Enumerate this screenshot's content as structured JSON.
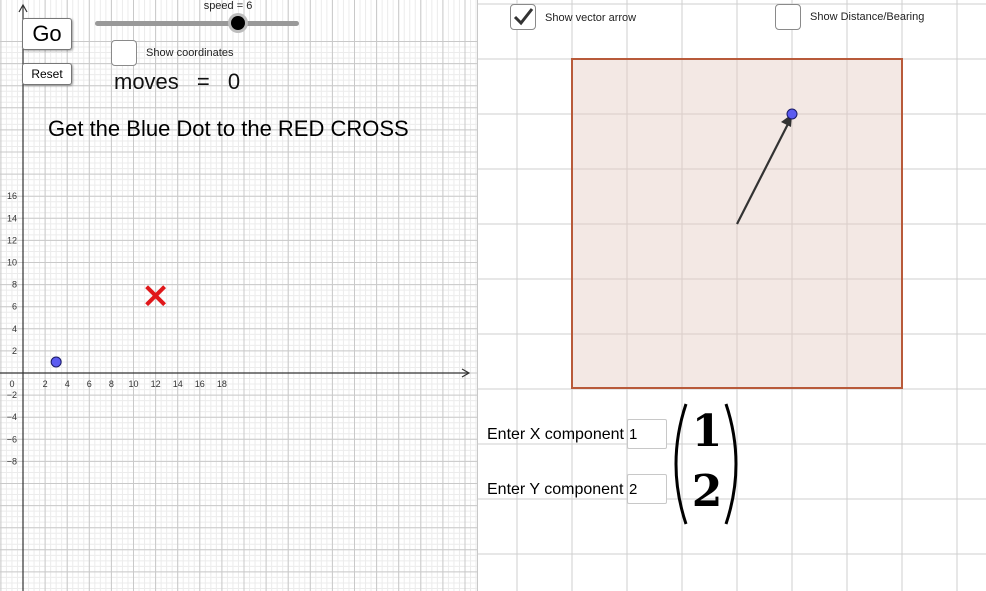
{
  "left_panel": {
    "go_label": "Go",
    "reset_label": "Reset",
    "slider_label": "speed = 6",
    "speed": {
      "min": 1,
      "max": 10,
      "value": 6
    },
    "show_coordinates_label": "Show coordinates",
    "show_coordinates_checked": false,
    "moves_label": "moves",
    "moves_eq": "=",
    "moves_value": "0",
    "instruction": "Get the Blue Dot to the RED CROSS",
    "graph": {
      "x_ticks": [
        "2",
        "4",
        "6",
        "8",
        "10",
        "12",
        "14",
        "16",
        "18"
      ],
      "y_ticks_pos": [
        "2",
        "4",
        "6",
        "8",
        "10",
        "12",
        "14",
        "16"
      ],
      "y_ticks_neg": [
        "−2",
        "−4",
        "−6",
        "−8"
      ],
      "origin_label": "0",
      "blue_dot": {
        "x": 3,
        "y": 1
      },
      "red_cross": {
        "x": 12,
        "y": 7
      }
    }
  },
  "right_panel": {
    "show_vector_label": "Show vector arrow",
    "show_vector_checked": true,
    "show_distance_label": "Show Distance/Bearing",
    "show_distance_checked": false,
    "x_label": "Enter X component",
    "x_value": "1",
    "y_label": "Enter Y component",
    "y_value": "2",
    "vector_x": "1",
    "vector_y": "2"
  },
  "colors": {
    "blue_dot": "#5b5bf0",
    "red_cross": "#e0171a",
    "box_border": "#b85a3a",
    "box_fill": "#f3e8e4"
  }
}
